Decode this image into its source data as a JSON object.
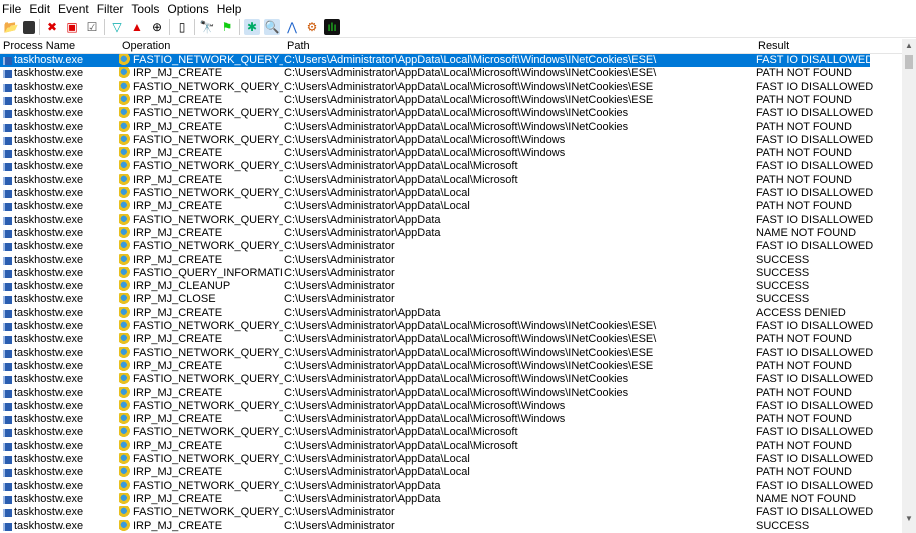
{
  "menu": [
    "File",
    "Edit",
    "Event",
    "Filter",
    "Tools",
    "Options",
    "Help"
  ],
  "toolbar": [
    "open-icon",
    "save-icon",
    "capture-icon",
    "autoscroll-icon",
    "clear-icon",
    "filter-icon",
    "highlight-icon",
    "include-process-icon",
    "jump-icon",
    "find-icon",
    "jump-to-icon",
    "show-registry-icon",
    "show-filesystem-icon",
    "show-network-icon",
    "show-process-icon",
    "show-profiling-icon"
  ],
  "columns": {
    "process": "Process Name",
    "operation": "Operation",
    "path": "Path",
    "result": "Result"
  },
  "rows": [
    [
      "taskhostw.exe",
      "FASTIO_NETWORK_QUERY_O...",
      "C:\\Users\\Administrator\\AppData\\Local\\Microsoft\\Windows\\INetCookies\\ESE\\",
      "FAST IO DISALLOWED"
    ],
    [
      "taskhostw.exe",
      "IRP_MJ_CREATE",
      "C:\\Users\\Administrator\\AppData\\Local\\Microsoft\\Windows\\INetCookies\\ESE\\",
      "PATH NOT FOUND"
    ],
    [
      "taskhostw.exe",
      "FASTIO_NETWORK_QUERY_O...",
      "C:\\Users\\Administrator\\AppData\\Local\\Microsoft\\Windows\\INetCookies\\ESE",
      "FAST IO DISALLOWED"
    ],
    [
      "taskhostw.exe",
      "IRP_MJ_CREATE",
      "C:\\Users\\Administrator\\AppData\\Local\\Microsoft\\Windows\\INetCookies\\ESE",
      "PATH NOT FOUND"
    ],
    [
      "taskhostw.exe",
      "FASTIO_NETWORK_QUERY_O...",
      "C:\\Users\\Administrator\\AppData\\Local\\Microsoft\\Windows\\INetCookies",
      "FAST IO DISALLOWED"
    ],
    [
      "taskhostw.exe",
      "IRP_MJ_CREATE",
      "C:\\Users\\Administrator\\AppData\\Local\\Microsoft\\Windows\\INetCookies",
      "PATH NOT FOUND"
    ],
    [
      "taskhostw.exe",
      "FASTIO_NETWORK_QUERY_O...",
      "C:\\Users\\Administrator\\AppData\\Local\\Microsoft\\Windows",
      "FAST IO DISALLOWED"
    ],
    [
      "taskhostw.exe",
      "IRP_MJ_CREATE",
      "C:\\Users\\Administrator\\AppData\\Local\\Microsoft\\Windows",
      "PATH NOT FOUND"
    ],
    [
      "taskhostw.exe",
      "FASTIO_NETWORK_QUERY_O...",
      "C:\\Users\\Administrator\\AppData\\Local\\Microsoft",
      "FAST IO DISALLOWED"
    ],
    [
      "taskhostw.exe",
      "IRP_MJ_CREATE",
      "C:\\Users\\Administrator\\AppData\\Local\\Microsoft",
      "PATH NOT FOUND"
    ],
    [
      "taskhostw.exe",
      "FASTIO_NETWORK_QUERY_O...",
      "C:\\Users\\Administrator\\AppData\\Local",
      "FAST IO DISALLOWED"
    ],
    [
      "taskhostw.exe",
      "IRP_MJ_CREATE",
      "C:\\Users\\Administrator\\AppData\\Local",
      "PATH NOT FOUND"
    ],
    [
      "taskhostw.exe",
      "FASTIO_NETWORK_QUERY_O...",
      "C:\\Users\\Administrator\\AppData",
      "FAST IO DISALLOWED"
    ],
    [
      "taskhostw.exe",
      "IRP_MJ_CREATE",
      "C:\\Users\\Administrator\\AppData",
      "NAME NOT FOUND"
    ],
    [
      "taskhostw.exe",
      "FASTIO_NETWORK_QUERY_O...",
      "C:\\Users\\Administrator",
      "FAST IO DISALLOWED"
    ],
    [
      "taskhostw.exe",
      "IRP_MJ_CREATE",
      "C:\\Users\\Administrator",
      "SUCCESS"
    ],
    [
      "taskhostw.exe",
      "FASTIO_QUERY_INFORMATION",
      "C:\\Users\\Administrator",
      "SUCCESS"
    ],
    [
      "taskhostw.exe",
      "IRP_MJ_CLEANUP",
      "C:\\Users\\Administrator",
      "SUCCESS"
    ],
    [
      "taskhostw.exe",
      "IRP_MJ_CLOSE",
      "C:\\Users\\Administrator",
      "SUCCESS"
    ],
    [
      "taskhostw.exe",
      "IRP_MJ_CREATE",
      "C:\\Users\\Administrator\\AppData",
      "ACCESS DENIED"
    ],
    [
      "taskhostw.exe",
      "FASTIO_NETWORK_QUERY_O...",
      "C:\\Users\\Administrator\\AppData\\Local\\Microsoft\\Windows\\INetCookies\\ESE\\",
      "FAST IO DISALLOWED"
    ],
    [
      "taskhostw.exe",
      "IRP_MJ_CREATE",
      "C:\\Users\\Administrator\\AppData\\Local\\Microsoft\\Windows\\INetCookies\\ESE\\",
      "PATH NOT FOUND"
    ],
    [
      "taskhostw.exe",
      "FASTIO_NETWORK_QUERY_O...",
      "C:\\Users\\Administrator\\AppData\\Local\\Microsoft\\Windows\\INetCookies\\ESE",
      "FAST IO DISALLOWED"
    ],
    [
      "taskhostw.exe",
      "IRP_MJ_CREATE",
      "C:\\Users\\Administrator\\AppData\\Local\\Microsoft\\Windows\\INetCookies\\ESE",
      "PATH NOT FOUND"
    ],
    [
      "taskhostw.exe",
      "FASTIO_NETWORK_QUERY_O...",
      "C:\\Users\\Administrator\\AppData\\Local\\Microsoft\\Windows\\INetCookies",
      "FAST IO DISALLOWED"
    ],
    [
      "taskhostw.exe",
      "IRP_MJ_CREATE",
      "C:\\Users\\Administrator\\AppData\\Local\\Microsoft\\Windows\\INetCookies",
      "PATH NOT FOUND"
    ],
    [
      "taskhostw.exe",
      "FASTIO_NETWORK_QUERY_O...",
      "C:\\Users\\Administrator\\AppData\\Local\\Microsoft\\Windows",
      "FAST IO DISALLOWED"
    ],
    [
      "taskhostw.exe",
      "IRP_MJ_CREATE",
      "C:\\Users\\Administrator\\AppData\\Local\\Microsoft\\Windows",
      "PATH NOT FOUND"
    ],
    [
      "taskhostw.exe",
      "FASTIO_NETWORK_QUERY_O...",
      "C:\\Users\\Administrator\\AppData\\Local\\Microsoft",
      "FAST IO DISALLOWED"
    ],
    [
      "taskhostw.exe",
      "IRP_MJ_CREATE",
      "C:\\Users\\Administrator\\AppData\\Local\\Microsoft",
      "PATH NOT FOUND"
    ],
    [
      "taskhostw.exe",
      "FASTIO_NETWORK_QUERY_O...",
      "C:\\Users\\Administrator\\AppData\\Local",
      "FAST IO DISALLOWED"
    ],
    [
      "taskhostw.exe",
      "IRP_MJ_CREATE",
      "C:\\Users\\Administrator\\AppData\\Local",
      "PATH NOT FOUND"
    ],
    [
      "taskhostw.exe",
      "FASTIO_NETWORK_QUERY_O...",
      "C:\\Users\\Administrator\\AppData",
      "FAST IO DISALLOWED"
    ],
    [
      "taskhostw.exe",
      "IRP_MJ_CREATE",
      "C:\\Users\\Administrator\\AppData",
      "NAME NOT FOUND"
    ],
    [
      "taskhostw.exe",
      "FASTIO_NETWORK_QUERY_O...",
      "C:\\Users\\Administrator",
      "FAST IO DISALLOWED"
    ],
    [
      "taskhostw.exe",
      "IRP_MJ_CREATE",
      "C:\\Users\\Administrator",
      "SUCCESS"
    ]
  ],
  "selected_row": 0,
  "colors": {
    "selection": "#0078d7"
  }
}
